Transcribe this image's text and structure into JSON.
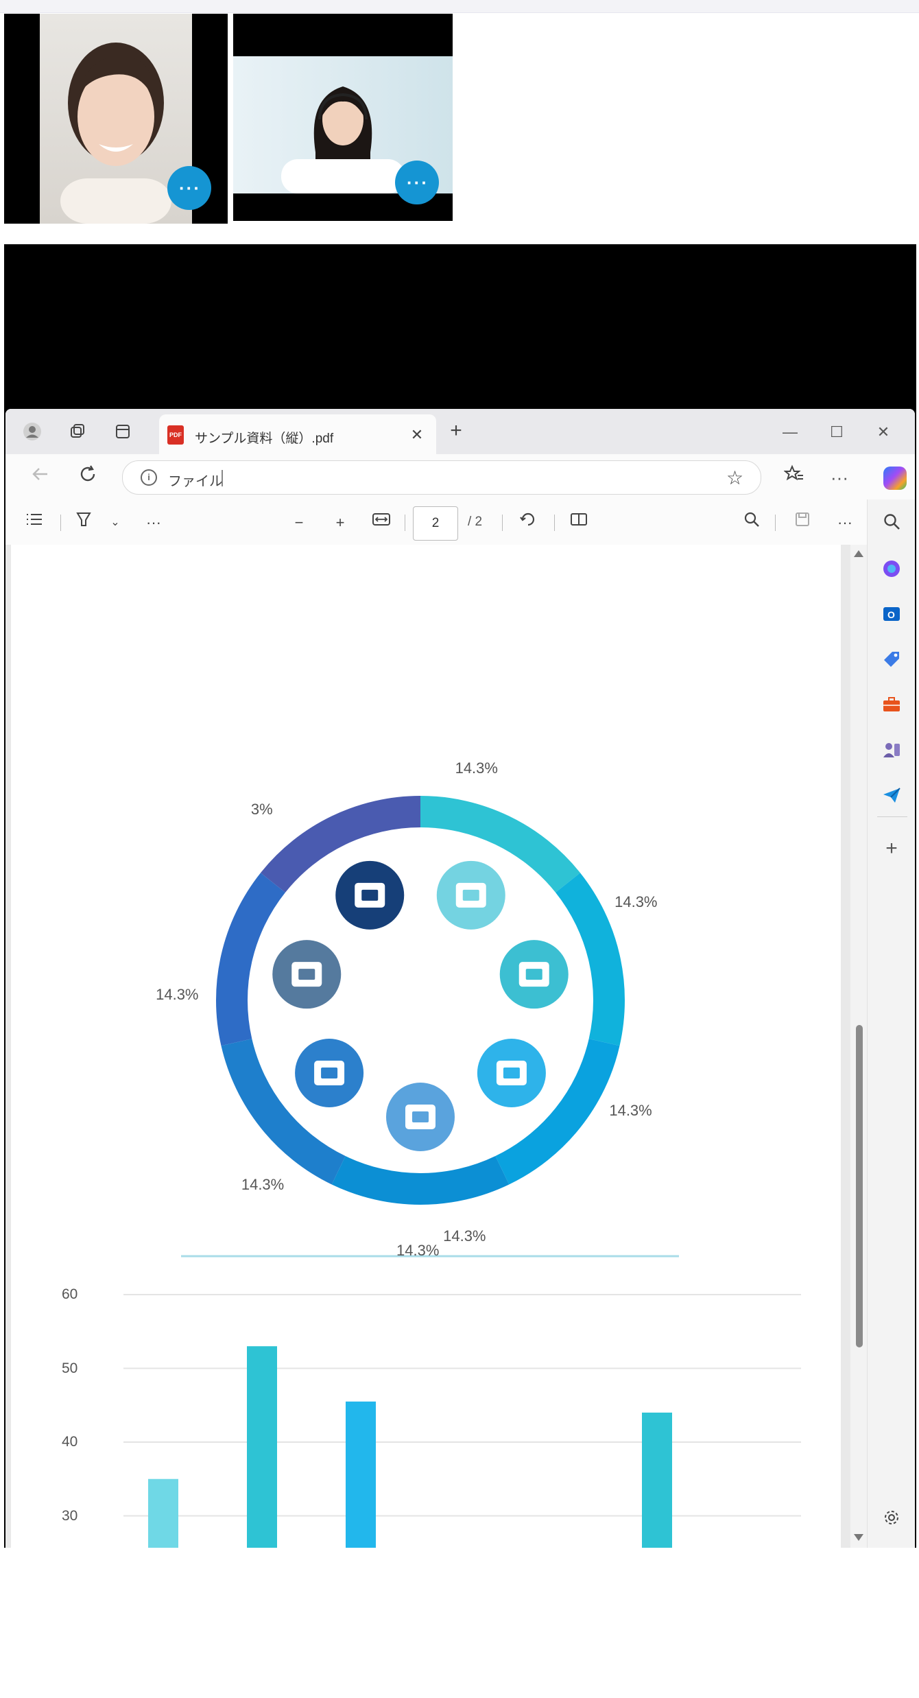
{
  "call": {
    "participants": [
      {
        "more_label": "···"
      },
      {
        "more_label": "···"
      }
    ]
  },
  "browser": {
    "tab": {
      "title": "サンプル資料（縦）.pdf",
      "pdf_badge": "PDF",
      "close": "✕"
    },
    "new_tab": "+",
    "window": {
      "minimize": "—",
      "maximize": "☐",
      "close": "✕"
    },
    "address": {
      "label": "ファイル",
      "info_glyph": "i"
    },
    "pdf_toolbar": {
      "current_page": "2",
      "page_count": "/ 2"
    }
  },
  "pdf_page": {
    "donut": {
      "labels": [
        "14.3%",
        "14.3%",
        "14.3%",
        "14.3%",
        "14.3%",
        "14.3%",
        "3%"
      ],
      "slice_colors": [
        "#2ec3d4",
        "#10b2dc",
        "#0aa2df",
        "#0c8fd4",
        "#1e7fcc",
        "#2e6cc6",
        "#4a5bb0"
      ],
      "icons": [
        {
          "name": "wallet-icon",
          "color": "#74d3e1"
        },
        {
          "name": "document-icon",
          "color": "#3cbfd2"
        },
        {
          "name": "checkmark-shield-icon",
          "color": "#2eb3ea"
        },
        {
          "name": "briefcase-icon",
          "color": "#5aa3dd"
        },
        {
          "name": "mail-icon",
          "color": "#2c80cc"
        },
        {
          "name": "inbox-icon",
          "color": "#557a9e"
        },
        {
          "name": "bar-chart-icon",
          "color": "#163f78"
        }
      ],
      "center_bottom_label": "14.3%"
    },
    "chart_data": {
      "type": "bar",
      "categories": [
        "",
        "",
        "",
        "",
        "",
        ""
      ],
      "values": [
        35,
        53,
        45.5,
        null,
        null,
        44
      ],
      "bar_colors": [
        "#6fd8e6",
        "#2ec3d4",
        "#22b7ec",
        "#2ec3d4",
        "#2ec3d4",
        "#2ec3d4"
      ],
      "yticks": [
        "60",
        "50",
        "40",
        "30"
      ],
      "ylim": [
        30,
        60
      ]
    }
  }
}
